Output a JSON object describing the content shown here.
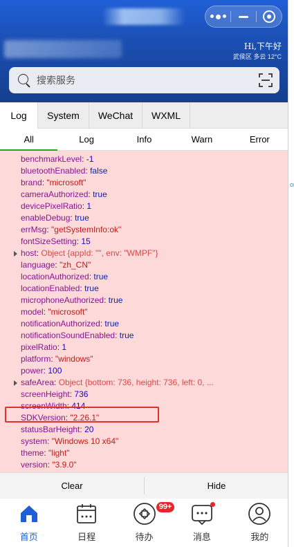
{
  "header": {
    "greeting": "Hi,下午好",
    "weather": "武侯区 多云 12°C",
    "search_placeholder": "搜索服务"
  },
  "vconsole": {
    "tabs": [
      "Log",
      "System",
      "WeChat",
      "WXML"
    ],
    "subtabs": [
      "All",
      "Log",
      "Info",
      "Warn",
      "Error"
    ],
    "footer": {
      "clear": "Clear",
      "hide": "Hide"
    },
    "stray_text": "or"
  },
  "log": [
    {
      "key": "benchmarkLevel",
      "value": "-1",
      "type": "num"
    },
    {
      "key": "bluetoothEnabled",
      "value": "false",
      "type": "bool"
    },
    {
      "key": "brand",
      "value": "\"microsoft\"",
      "type": "str"
    },
    {
      "key": "cameraAuthorized",
      "value": "true",
      "type": "bool"
    },
    {
      "key": "devicePixelRatio",
      "value": "1",
      "type": "num"
    },
    {
      "key": "enableDebug",
      "value": "true",
      "type": "bool"
    },
    {
      "key": "errMsg",
      "value": "\"getSystemInfo:ok\"",
      "type": "str"
    },
    {
      "key": "fontSizeSetting",
      "value": "15",
      "type": "num"
    },
    {
      "key": "host",
      "value": "Object {appId: \"\", env: \"WMPF\"}",
      "type": "obj"
    },
    {
      "key": "language",
      "value": "\"zh_CN\"",
      "type": "str"
    },
    {
      "key": "locationAuthorized",
      "value": "true",
      "type": "bool"
    },
    {
      "key": "locationEnabled",
      "value": "true",
      "type": "bool"
    },
    {
      "key": "microphoneAuthorized",
      "value": "true",
      "type": "bool"
    },
    {
      "key": "model",
      "value": "\"microsoft\"",
      "type": "str"
    },
    {
      "key": "notificationAuthorized",
      "value": "true",
      "type": "bool"
    },
    {
      "key": "notificationSoundEnabled",
      "value": "true",
      "type": "bool"
    },
    {
      "key": "pixelRatio",
      "value": "1",
      "type": "num"
    },
    {
      "key": "platform",
      "value": "\"windows\"",
      "type": "str"
    },
    {
      "key": "power",
      "value": "100",
      "type": "num"
    },
    {
      "key": "safeArea",
      "value": "Object {bottom: 736, height: 736, left: 0, ...",
      "type": "obj"
    },
    {
      "key": "screenHeight",
      "value": "736",
      "type": "num"
    },
    {
      "key": "screenWidth",
      "value": "414",
      "type": "num"
    },
    {
      "key": "SDKVersion",
      "value": "\"2.26.1\"",
      "type": "str"
    },
    {
      "key": "statusBarHeight",
      "value": "20",
      "type": "num"
    },
    {
      "key": "system",
      "value": "\"Windows 10 x64\"",
      "type": "str"
    },
    {
      "key": "theme",
      "value": "\"light\"",
      "type": "str"
    },
    {
      "key": "version",
      "value": "\"3.9.0\"",
      "type": "str"
    }
  ],
  "tabbar": {
    "items": [
      {
        "label": "首页",
        "icon": "home-icon"
      },
      {
        "label": "日程",
        "icon": "calendar-icon"
      },
      {
        "label": "待办",
        "icon": "todo-icon"
      },
      {
        "label": "消息",
        "icon": "message-icon"
      },
      {
        "label": "我的",
        "icon": "profile-icon"
      }
    ],
    "todo_badge": "99+"
  },
  "colors": {
    "header_blue": "#1f5fd6",
    "log_bg": "#fdd9d9",
    "highlight": "#e5302a",
    "badge": "#e5262a"
  }
}
